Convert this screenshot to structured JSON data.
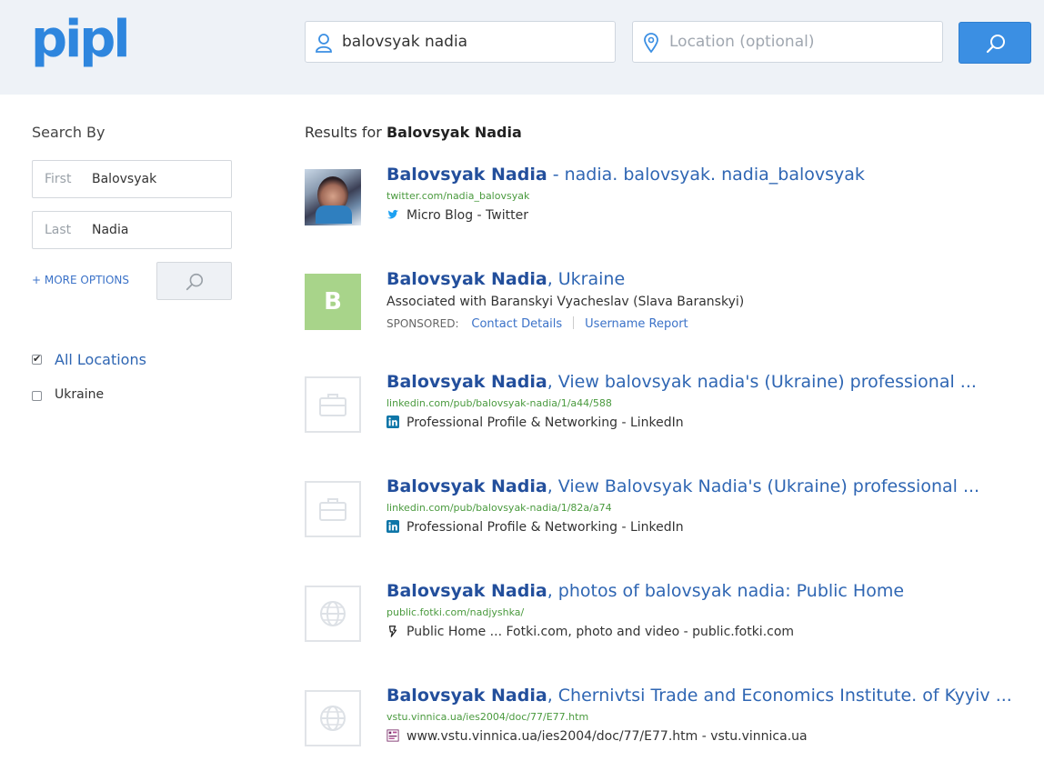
{
  "header": {
    "logo": "pipl",
    "name_value": "balovsyak nadia",
    "location_placeholder": "Location (optional)"
  },
  "sidebar": {
    "title": "Search By",
    "first_label": "First",
    "first_value": "Balovsyak",
    "last_label": "Last",
    "last_value": "Nadia",
    "more_options": "+ MORE OPTIONS",
    "locations": [
      {
        "label": "All Locations",
        "checked": true
      },
      {
        "label": "Ukraine",
        "checked": false
      }
    ]
  },
  "results": {
    "prefix": "Results for",
    "query": "Balovsyak Nadia",
    "items": [
      {
        "name": "Balovsyak Nadia",
        "rest": " - nadia. balovsyak. nadia_balovsyak",
        "url": "twitter.com/nadia_balovsyak",
        "source": "Micro Blog - Twitter",
        "icon": "twitter-icon"
      },
      {
        "name": "Balovsyak Nadia",
        "rest": ", Ukraine",
        "letter": "B",
        "assoc": "Associated with Baranskyi Vyacheslav (Slava Baranskyi)",
        "sponsored": "SPONSORED:",
        "link1": "Contact Details",
        "link2": "Username Report"
      },
      {
        "name": "Balovsyak Nadia",
        "rest": ", View balovsyak nadia's (Ukraine) professional ...",
        "url": "linkedin.com/pub/balovsyak-nadia/1/a44/588",
        "source": "Professional Profile & Networking - LinkedIn",
        "icon": "linkedin-icon"
      },
      {
        "name": "Balovsyak Nadia",
        "rest": ", View Balovsyak Nadia's (Ukraine) professional ...",
        "url": "linkedin.com/pub/balovsyak-nadia/1/82a/a74",
        "source": "Professional Profile & Networking - LinkedIn",
        "icon": "linkedin-icon"
      },
      {
        "name": "Balovsyak Nadia",
        "rest": ", photos of balovsyak nadia: Public Home",
        "url": "public.fotki.com/nadjyshka/",
        "source": "Public Home ... Fotki.com, photo and video - public.fotki.com",
        "icon": "fotki-icon"
      },
      {
        "name": "Balovsyak Nadia",
        "rest": ", Chernivtsi Trade and Economics Institute. of Kyyiv ...",
        "url": "vstu.vinnica.ua/ies2004/doc/77/E77.htm",
        "source": "www.vstu.vinnica.ua/ies2004/doc/77/E77.htm - vstu.vinnica.ua",
        "icon": "site-favicon-icon"
      }
    ]
  },
  "colors": {
    "accent": "#3b8fe3",
    "link": "#2f66b3",
    "url": "#4a9a3e",
    "header_bg": "#eef2f7"
  }
}
